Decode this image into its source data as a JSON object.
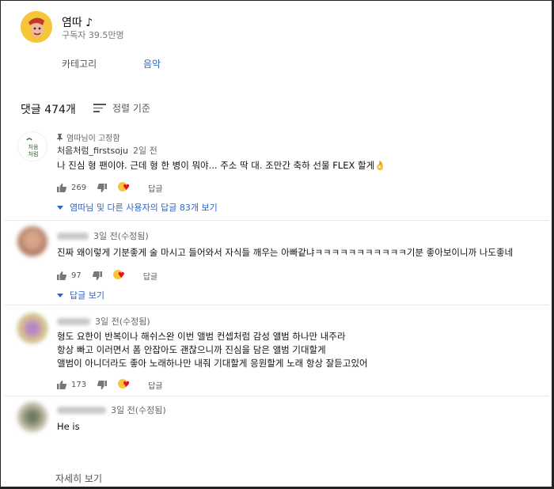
{
  "channel": {
    "name": "염따 ♪",
    "subscribers": "구독자 39.5만명",
    "tabs": [
      "카테고리",
      "음악"
    ]
  },
  "comments_header": {
    "count": "댓글 474개",
    "sort_label": "정렬 기준"
  },
  "comments": [
    {
      "pinned": "염따님이 고정함",
      "author": "처음처럼_firstsoju",
      "time": "2일 전",
      "lines": [
        "나 진심 형 팬이야. 근데 형 한 병이 뭐야... 주소 딱 대. 조만간 축하 선물 FLEX 할게👌"
      ],
      "likes": "269",
      "reply_label": "답글",
      "replies_link": "염따님 및 다른 사용자의 답글 83개 보기"
    },
    {
      "time": "3일 전(수정됨)",
      "lines": [
        "진짜 왜이렇게 기분좋게 술 마시고 들어와서 자식들 깨우는 아빠같냐ㅋㅋㅋㅋㅋㅋㅋㅋㅋㅋㅋ기분 좋아보이니까 나도좋네"
      ],
      "likes": "97",
      "reply_label": "답글",
      "replies_link": "답글 보기"
    },
    {
      "time": "3일 전(수정됨)",
      "lines": [
        "형도 요한이 반복이나 해쉬스완 이번 앨범 컨셉처럼 감성 앨범 하나만 내주라",
        "항상 빠고 이러면서 폼 안잡아도 괜찮으니까 진심을 담은 앨범 기대할게",
        "앨범이 아니더라도 좋아 노래하나만 내줘 기대할게 응원할게 노래 항상 잘듣고있어"
      ],
      "likes": "173",
      "reply_label": "답글"
    },
    {
      "time": "3일 전(수정됨)",
      "lines": [
        "He is"
      ]
    }
  ],
  "footer": {
    "more_label": "자세히 보기"
  },
  "colors": {
    "link": "#2f63c4",
    "heart": "#e0141e",
    "avatar_yellow": "#f6c53a"
  }
}
